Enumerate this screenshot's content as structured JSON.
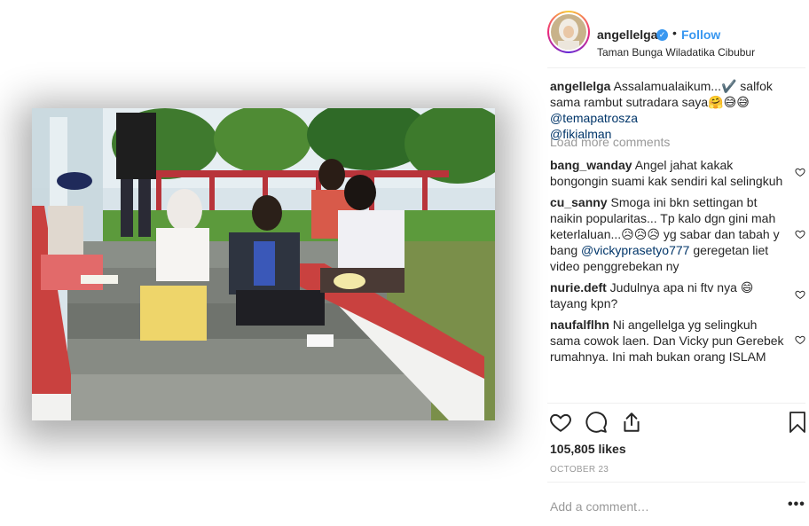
{
  "post": {
    "username": "angellelga",
    "verified_mark": "✓",
    "separator": "•",
    "follow_label": "Follow",
    "location": "Taman Bunga Wiladatika Cibubur",
    "image_alt": "Photo of four people sitting on stone steps in a park"
  },
  "caption": {
    "user": "angellelga",
    "text_a": " Assalamualaikum...✔️ salfok sama rambut sutradara saya🤗😅😅 ",
    "mention_1": "@temapatrosza",
    "mention_2": "@fikialman"
  },
  "load_more_label": "Load more comments",
  "comments": [
    {
      "user": "bang_wanday",
      "text": " Angel jahat kakak bongongin suami kak sendiri kal selingkuh"
    },
    {
      "user": "cu_sanny",
      "text_a": " Smoga ini bkn settingan bt naikin popularitas... Tp kalo dgn gini mah keterlaluan...😥😥😥 yg sabar dan tabah y bang ",
      "mention": "@vickyprasetyo777",
      "text_b": " geregetan liet video penggrebekan ny"
    },
    {
      "user": "nurie.deft",
      "text": " Judulnya apa ni ftv nya 😄 tayang kpn?"
    },
    {
      "user": "naufalflhn",
      "text": " Ni angellelga yg selingkuh sama cowok laen. Dan Vicky pun Gerebek rumahnya. Ini mah bukan orang ISLAM"
    }
  ],
  "actions": {
    "like_icon": "heart-icon",
    "comment_icon": "comment-bubble-icon",
    "share_icon": "share-icon",
    "save_icon": "bookmark-icon"
  },
  "likes_text": "105,805 likes",
  "date_text": "OCTOBER 23",
  "add_comment_placeholder": "Add a comment…",
  "more_label": "•••",
  "colors": {
    "link_blue": "#3897f0",
    "mention_navy": "#003569",
    "muted_gray": "#999999",
    "text": "#262626"
  }
}
